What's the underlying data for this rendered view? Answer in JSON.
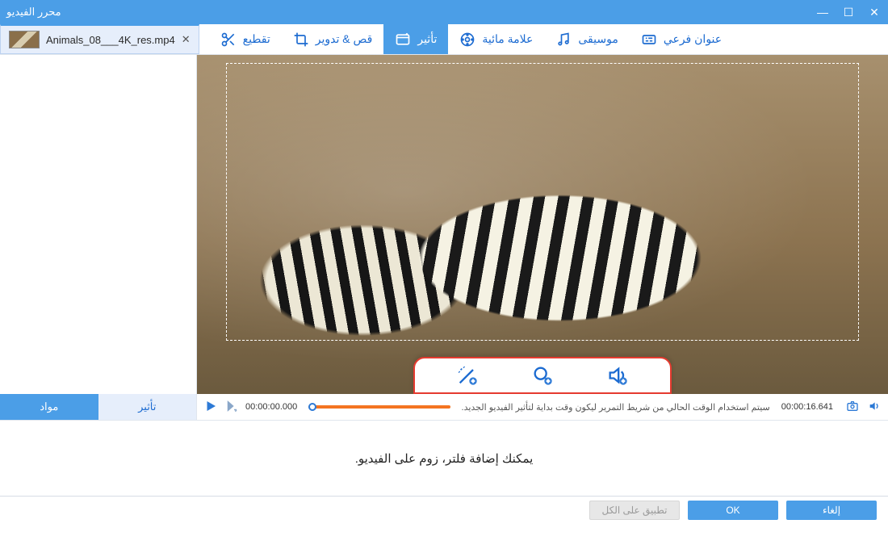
{
  "window": {
    "title": "محرر الفيديو"
  },
  "file_tab": {
    "name": "Animals_08___4K_res.mp4"
  },
  "tool_tabs": {
    "trim": {
      "label": "تقطيع",
      "icon": "scissors-icon"
    },
    "crop": {
      "label": "قص & تدوير",
      "icon": "crop-icon"
    },
    "effect": {
      "label": "تأثير",
      "icon": "effect-icon",
      "active": true
    },
    "watermark": {
      "label": "علامة مائية",
      "icon": "watermark-icon"
    },
    "music": {
      "label": "موسيقى",
      "icon": "music-icon"
    },
    "subtitle": {
      "label": "عنوان فرعي",
      "icon": "subtitle-icon"
    }
  },
  "side_tabs": {
    "materials": "مواد",
    "effects": "تأثير"
  },
  "timecode": {
    "current": "00:00:00.000",
    "total": "00:00:16.641"
  },
  "hint_text": "سيتم استخدام الوقت الحالي من شريط التمرير ليكون وقت بداية لتأثير الفيديو الجديد.",
  "description": "يمكنك إضافة فلتر، زوم على الفيديو.",
  "footer": {
    "apply_all": "تطبيق على الكل",
    "ok": "OK",
    "cancel": "إلغاء"
  }
}
